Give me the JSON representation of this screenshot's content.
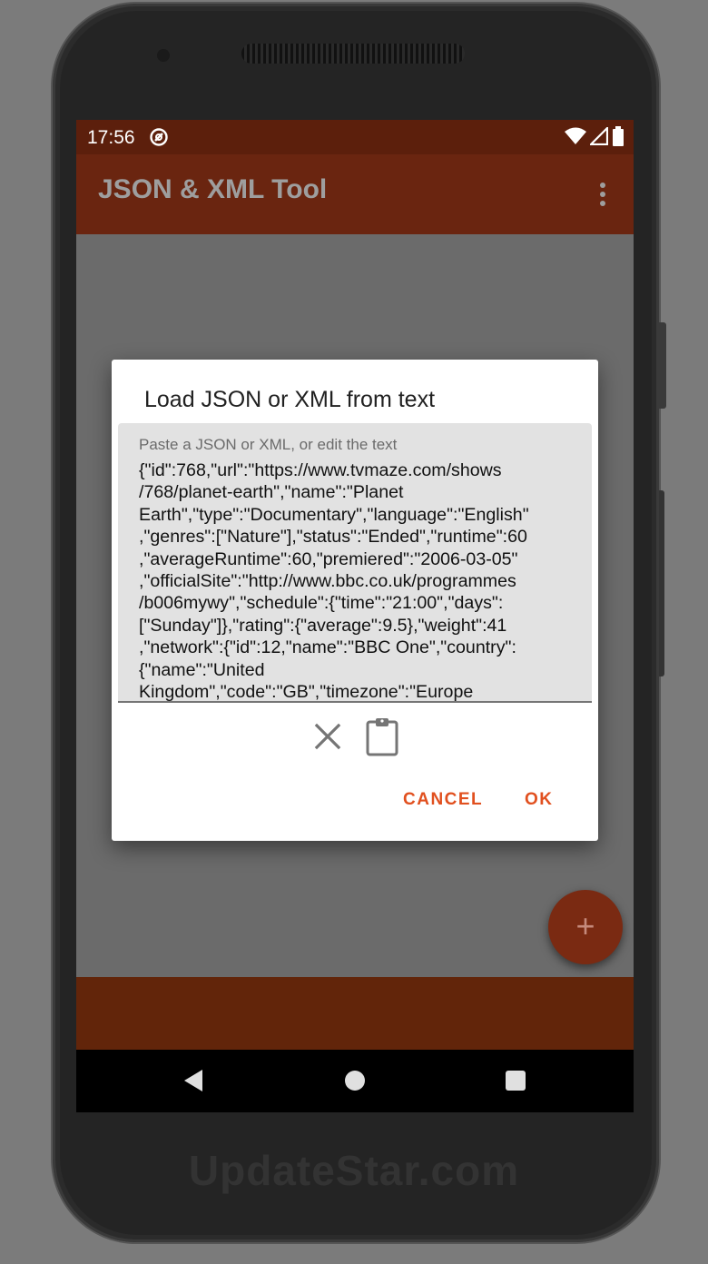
{
  "status_bar": {
    "time": "17:56",
    "icons": [
      "app-notification-icon",
      "wifi-icon",
      "signal-icon",
      "battery-icon"
    ]
  },
  "app_bar": {
    "title": "JSON & XML Tool",
    "menu_icon": "more-vert-icon"
  },
  "dialog": {
    "title": "Load JSON or XML from text",
    "field_hint": "Paste a JSON or XML, or edit the text",
    "field_value": "{\"id\":768,\"url\":\"https://www.tvmaze.com/shows\n/768/planet-earth\",\"name\":\"Planet\nEarth\",\"type\":\"Documentary\",\"language\":\"English\"\n,\"genres\":[\"Nature\"],\"status\":\"Ended\",\"runtime\":60\n,\"averageRuntime\":60,\"premiered\":\"2006-03-05\"\n,\"officialSite\":\"http://www.bbc.co.uk/programmes\n/b006mywy\",\"schedule\":{\"time\":\"21:00\",\"days\":\n[\"Sunday\"]},\"rating\":{\"average\":9.5},\"weight\":41\n,\"network\":{\"id\":12,\"name\":\"BBC One\",\"country\":\n{\"name\":\"United\nKingdom\",\"code\":\"GB\",\"timezone\":\"Europe",
    "clear_icon": "close-icon",
    "paste_icon": "clipboard-icon",
    "cancel_label": "CANCEL",
    "ok_label": "OK"
  },
  "fab": {
    "label": "+",
    "icon": "add-icon"
  },
  "nav_bar": {
    "icons": [
      "back-icon",
      "home-icon",
      "recents-icon"
    ]
  },
  "watermark": "UpdateStar.com",
  "colors": {
    "accent": "#e1501f",
    "primary_dimmed": "#6a2510",
    "status_dimmed": "#5c1f0c"
  }
}
